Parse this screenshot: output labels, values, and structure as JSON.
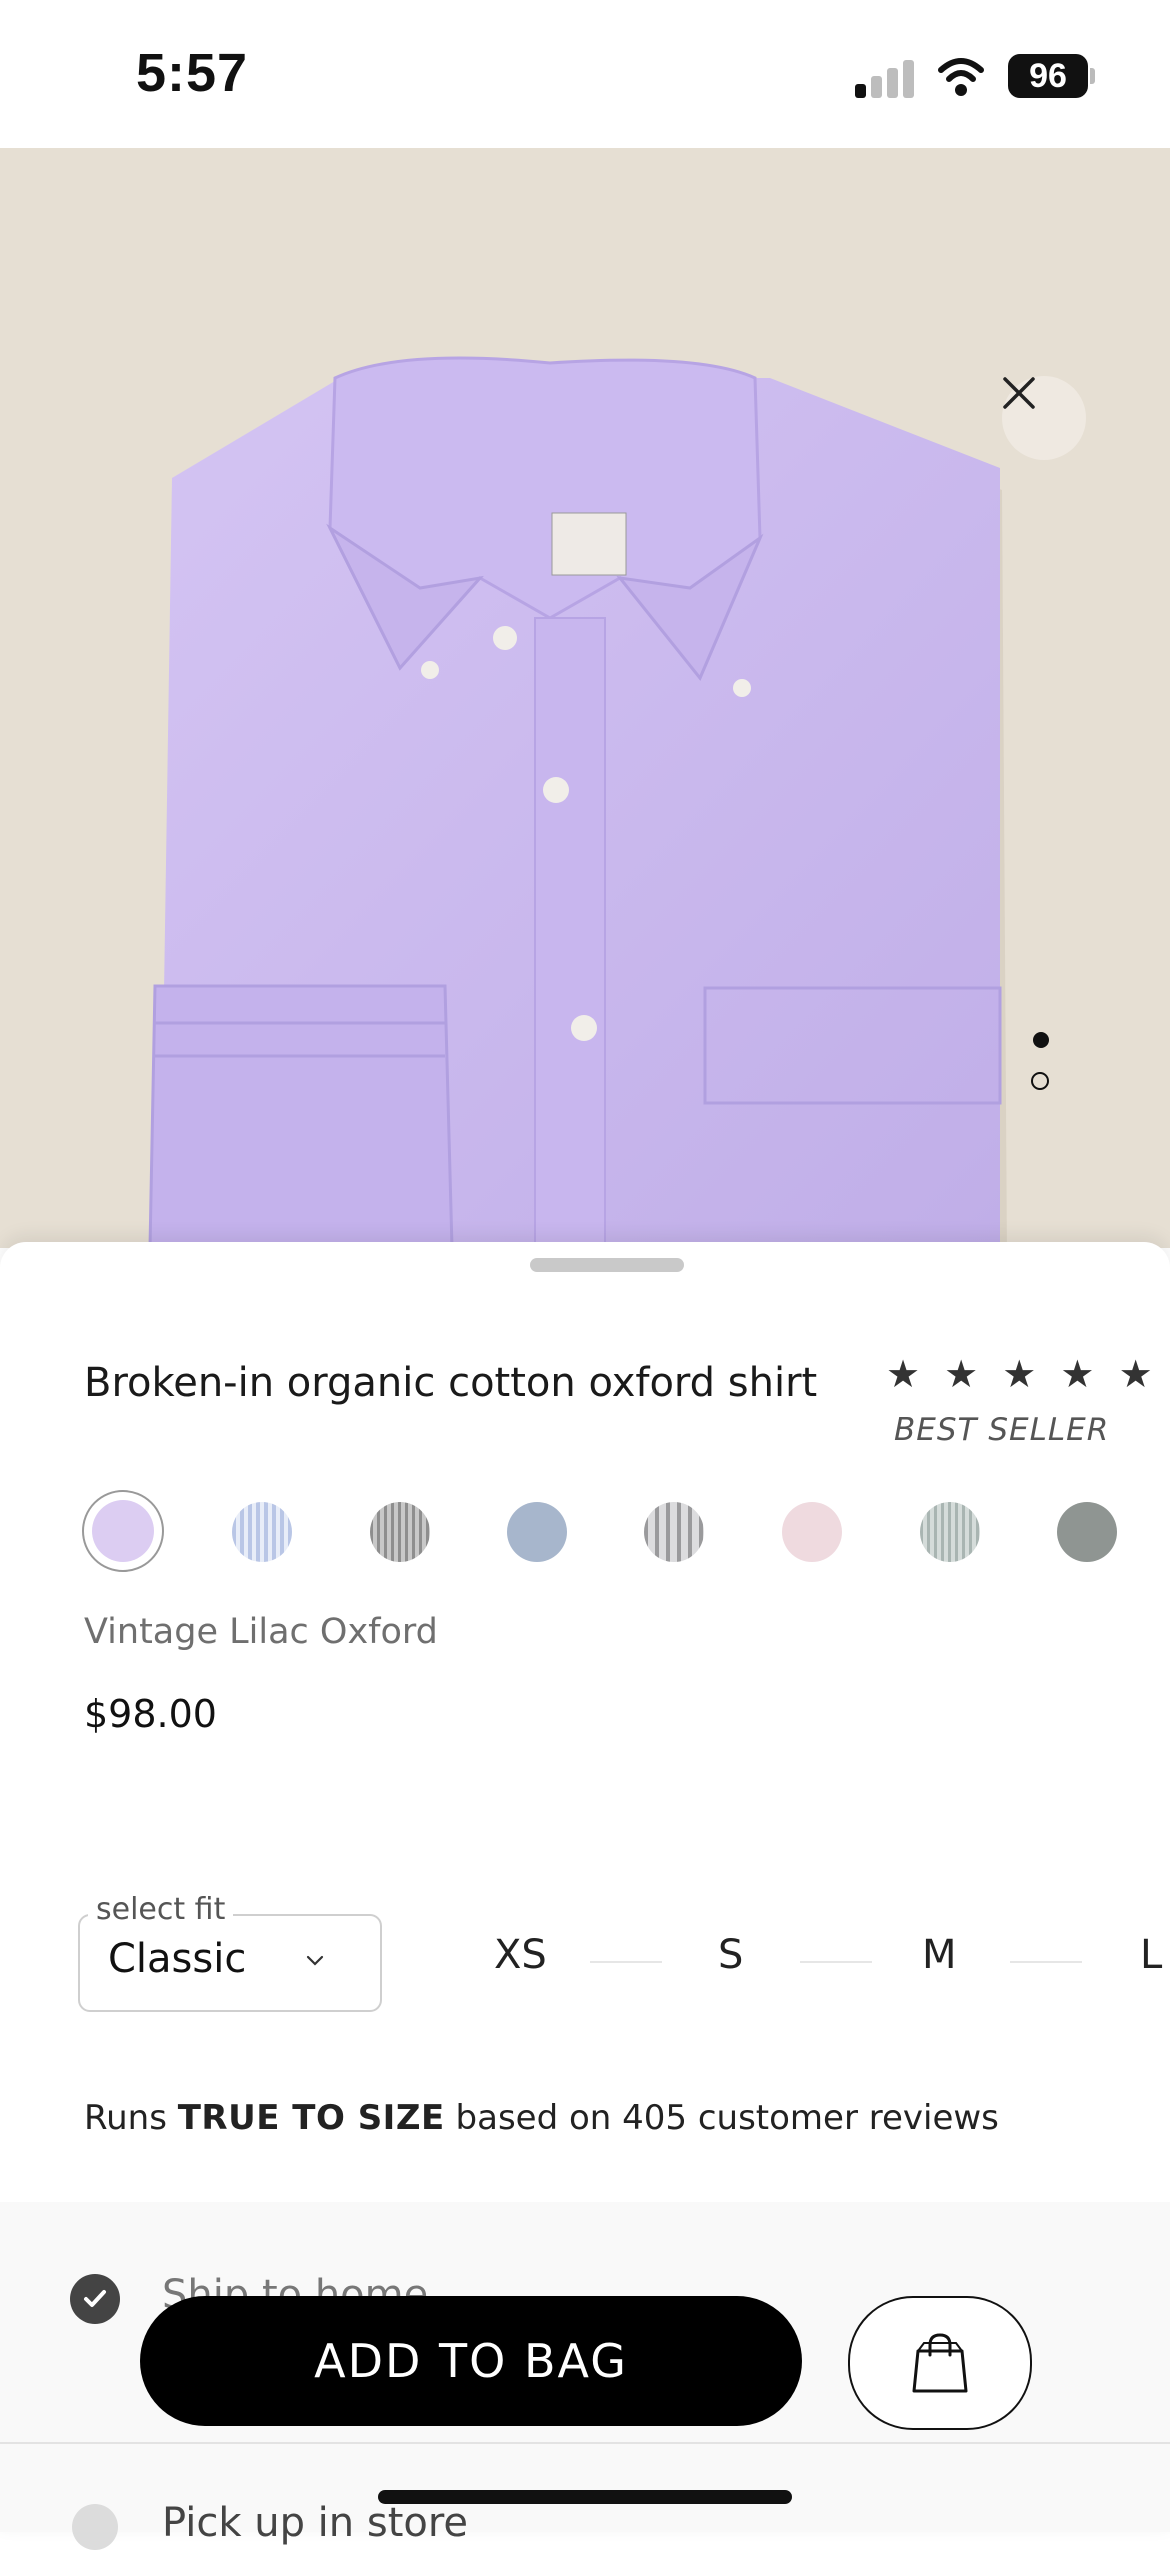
{
  "status_bar": {
    "time": "5:57",
    "battery": "96",
    "signal_icon": "cellular-signal-icon",
    "wifi_icon": "wifi-icon"
  },
  "hero": {
    "close_icon": "close-icon",
    "page_indicator": {
      "total": 2,
      "active": 1
    },
    "background_color": "#e6dfd3",
    "shirt_color": "#c9b8ec"
  },
  "product": {
    "title": "Broken-in organic cotton oxford shirt",
    "rating_stars": "★ ★ ★ ★ ★",
    "badge": "BEST SELLER",
    "selected_color": "Vintage Lilac Oxford",
    "price": "$98.00",
    "swatches": [
      {
        "name": "lilac",
        "color": "#dccdf2",
        "selected": true
      },
      {
        "name": "blue-stripe",
        "color": "#b9c6e6"
      },
      {
        "name": "grey-stripe",
        "color": "#9e9e9e"
      },
      {
        "name": "chambray",
        "color": "#a7b6cc"
      },
      {
        "name": "grey-white-stripe",
        "color": "#b6b6b8"
      },
      {
        "name": "pink",
        "color": "#efdadf"
      },
      {
        "name": "green-stripe",
        "color": "#b9c3c1"
      },
      {
        "name": "heather-grey",
        "color": "#8f9592"
      }
    ]
  },
  "fit": {
    "legend": "select fit",
    "value": "Classic",
    "chevron_icon": "chevron-down-icon"
  },
  "sizes": [
    "XS",
    "S",
    "M",
    "L"
  ],
  "fit_note": {
    "prefix": "Runs ",
    "emphasis": "TRUE TO SIZE",
    "suffix": " based on 405 customer reviews"
  },
  "delivery": {
    "ship_label": "Ship to home",
    "pickup_label": "Pick up in store"
  },
  "actions": {
    "add_to_bag": "ADD TO BAG",
    "bag_icon": "shopping-bag-icon"
  }
}
